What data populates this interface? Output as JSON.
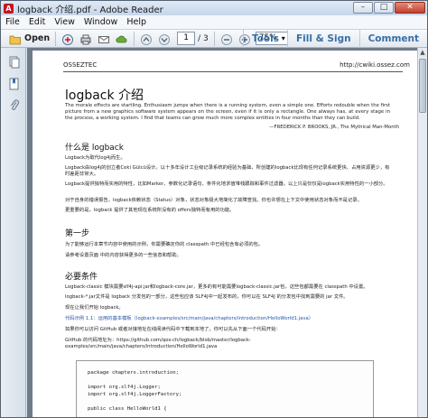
{
  "window": {
    "title": "logback 介绍.pdf - Adobe Reader",
    "controls": [
      "–",
      "□",
      "✕"
    ]
  },
  "menubar": {
    "items": [
      "File",
      "Edit",
      "View",
      "Window",
      "Help"
    ]
  },
  "toolbar": {
    "open_label": "Open",
    "page_current": "1",
    "page_total": "/ 3",
    "zoom": "75%",
    "tools": "Tools",
    "fill_sign": "Fill & Sign",
    "comment": "Comment"
  },
  "document": {
    "header_left": "OSSEZTEC",
    "header_right": "http://cwiki.ossez.com",
    "title": "logback 介绍",
    "epigraph": "The morale effects are startling. Enthusiasm jumps when there is a running system, even a simple one. Efforts redouble when the first picture from a new graphics software system appears on the screen, even if it is only a rectangle. One always has, at every stage in the process, a working system. I find that teams can grow much more complex entities in four months than they can build.",
    "attribution": "—FREDERICK P. BROOKS, JR., The Mythical Man-Month",
    "section1": {
      "heading": "什么是 logback",
      "paragraphs": [
        "Logback为取代log4j而生。",
        "Logback由log4j的创立者Ceki Gülcü设计。以十多年设计工业级记录系统的经验为基础，所创建的logback比现有任何记录系统更快、占用资源更少，有时差距非常大。",
        "Logback提供独特而实用的特性，比如Marker、参数化记录语句、条件化地求值堆栈跟踪和事件过滤器。以上只是仅仅是logback实用特性的一小部分。",
        "对于自身的错误报告，logback依赖状态（Status）对象，状态对象极大地简化了故障查找。你也许想在上下文中使用状态对象而不是记录。",
        "更重要的是，logback 提供了其他现在系统所没有的 offers独特而有用的功能。"
      ]
    },
    "section2": {
      "heading": "第一步",
      "paragraphs": [
        "为了能够运行本章节内容中使用的示例，你需要确定你的 classpath 中已经包含有必须的包。",
        "请参考设置页面 中的内容获得更多的一些信息和帮助。"
      ]
    },
    "section3": {
      "heading": "必要条件",
      "paragraphs": [
        "Logback-classic 模块需要slf4j-api.jar和logback-core.jar，更多的有可能需要logback-classic.jar包，这些包都需要在 classpath 中设置。",
        "logback-*.jar文件是 logback 分发包的一部分，这些包应该 SLF4J中一起发布的，你可以在 SLF4J 的分发包中找到需要的 jar 文件。",
        "现在让我们开始 logback。",
        "代码示例 1.1：运用的基本模板（logback-examples/src/main/java/chapters/introduction/HelloWorld1.java）",
        "如果你可以访问 GitHub 或者对接地址在线阅读代码中下载到本地了。你可以先从下面一个代码开始：",
        "GitHub 的代码地址为：https://github.com/qos-ch/logback/blob/master/logback-examples/src/main/java/chapters/introduction/HelloWorld1.java"
      ]
    },
    "code": [
      "package chapters.introduction;",
      "import org.slf4j.Logger;",
      "import org.slf4j.LoggerFactory;",
      "public class HelloWorld1 {"
    ]
  }
}
